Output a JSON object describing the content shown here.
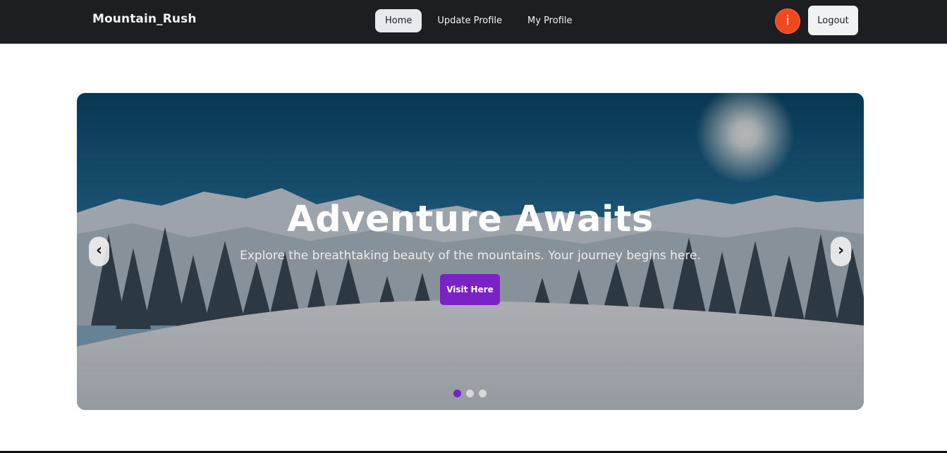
{
  "header": {
    "brand": "Mountain_Rush",
    "nav": [
      {
        "label": "Home",
        "active": true
      },
      {
        "label": "Update Profile",
        "active": false
      },
      {
        "label": "My Profile",
        "active": false
      }
    ],
    "avatar_initial": "i",
    "logout_label": "Logout"
  },
  "hero": {
    "title": "Adventure Awaits",
    "subtitle": "Explore the breathtaking beauty of the mountains. Your journey begins here.",
    "cta_label": "Visit Here",
    "prev_icon": "‹",
    "next_icon": "›",
    "slide_count": 3,
    "active_slide": 1
  },
  "colors": {
    "navbar": "#1d1e21",
    "accent": "#7b22c6",
    "avatar": "#f04a1c"
  }
}
